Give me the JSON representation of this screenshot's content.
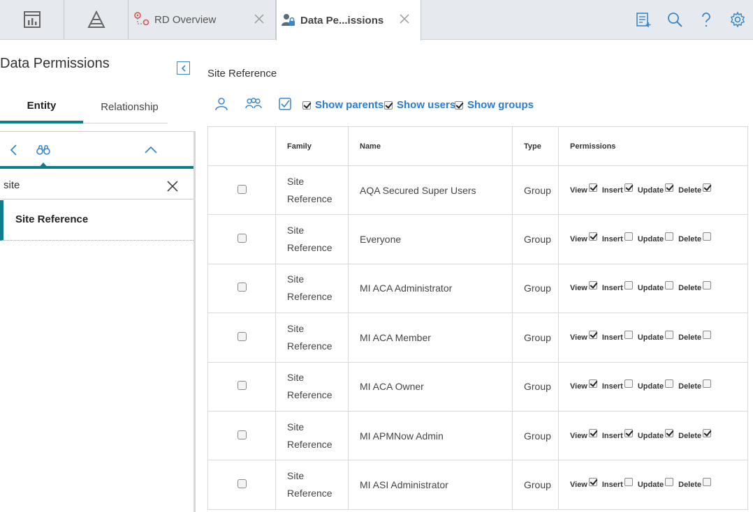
{
  "tabs": {
    "tab1": {
      "label": "RD Overview"
    },
    "tab2": {
      "label": "Data Pe...issions"
    }
  },
  "left": {
    "title": "Data Permissions",
    "tabs": {
      "entity": "Entity",
      "relationship": "Relationship"
    },
    "search": {
      "value": "site"
    },
    "result": "Site Reference"
  },
  "right": {
    "title": "Site Reference",
    "filters": {
      "parents": "Show parents",
      "users": "Show users",
      "groups": "Show groups"
    },
    "columns": {
      "family": "Family",
      "name": "Name",
      "type": "Type",
      "permissions": "Permissions"
    },
    "perm_labels": {
      "view": "View",
      "insert": "Insert",
      "update": "Update",
      "delete": "Delete"
    },
    "rows": [
      {
        "family_1": "Site",
        "family_2": "Reference",
        "name": "AQA Secured Super Users",
        "type": "Group",
        "view": true,
        "insert": true,
        "update": true,
        "delete": true
      },
      {
        "family_1": "Site",
        "family_2": "Reference",
        "name": "Everyone",
        "type": "Group",
        "view": true,
        "insert": false,
        "update": false,
        "delete": false
      },
      {
        "family_1": "Site",
        "family_2": "Reference",
        "name": "MI ACA Administrator",
        "type": "Group",
        "view": true,
        "insert": false,
        "update": false,
        "delete": false
      },
      {
        "family_1": "Site",
        "family_2": "Reference",
        "name": "MI ACA Member",
        "type": "Group",
        "view": true,
        "insert": false,
        "update": false,
        "delete": false
      },
      {
        "family_1": "Site",
        "family_2": "Reference",
        "name": "MI ACA Owner",
        "type": "Group",
        "view": true,
        "insert": false,
        "update": false,
        "delete": false
      },
      {
        "family_1": "Site",
        "family_2": "Reference",
        "name": "MI APMNow Admin",
        "type": "Group",
        "view": true,
        "insert": true,
        "update": true,
        "delete": true
      },
      {
        "family_1": "Site",
        "family_2": "Reference",
        "name": "MI ASI Administrator",
        "type": "Group",
        "view": true,
        "insert": false,
        "update": false,
        "delete": false
      }
    ]
  },
  "colors": {
    "accent": "#0e7c8c",
    "link": "#2b7cd3",
    "topbar": "#e6eaee"
  },
  "icons": {
    "top": [
      "dashboard-icon",
      "hierarchy-icon",
      "route-map-icon",
      "user-lock-icon"
    ],
    "actions": [
      "notes-icon",
      "search-icon",
      "help-icon",
      "gear-icon"
    ],
    "tree": [
      "chevron-left-icon",
      "binoculars-icon",
      "chevron-up-icon"
    ],
    "toolbar": [
      "user-icon",
      "group-icon",
      "select-all-icon"
    ]
  }
}
